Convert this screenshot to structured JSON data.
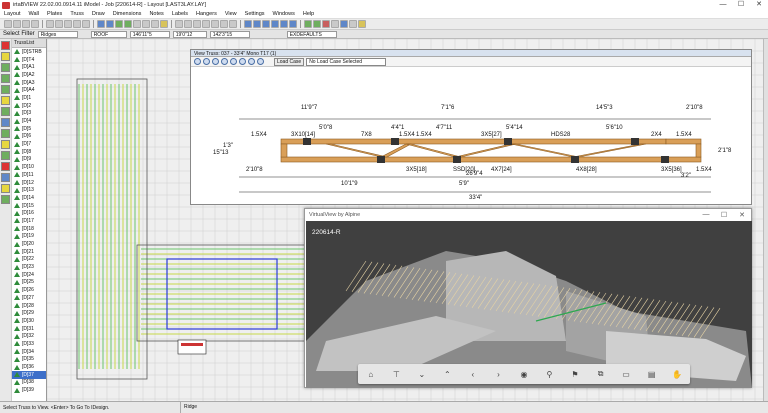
{
  "window": {
    "title": "irtaBVIEW 22.02.00.0914.11 iModel - Job [220614-R] - Layout [LAST3LAY.LAY]",
    "minimize": "—",
    "maximize": "☐",
    "close": "✕"
  },
  "menu": [
    "Layout",
    "Wall",
    "Plates",
    "Truss",
    "Draw",
    "Dimensions",
    "Notes",
    "Labels",
    "Hangers",
    "View",
    "Settings",
    "Windows",
    "Help"
  ],
  "filters": {
    "label": "Select Filter",
    "ridge": "Ridges",
    "level": "ROOF",
    "coord1": "146'11\"5",
    "coord2": "19'0\"12",
    "coord3": "142'3\"15",
    "layer": "EXDEFAULTS"
  },
  "truss_list": {
    "header": "TrussList",
    "items": [
      "[D]STRB",
      "[D]T4",
      "[D]A1",
      "[D]A2",
      "[D]A3",
      "[D]A4",
      "[D]1",
      "[D]2",
      "[D]3",
      "[D]4",
      "[D]5",
      "[D]6",
      "[D]7",
      "[D]8",
      "[D]9",
      "[D]10",
      "[D]11",
      "[D]12",
      "[D]13",
      "[D]14",
      "[D]15",
      "[D]16",
      "[D]17",
      "[D]18",
      "[D]19",
      "[D]20",
      "[D]21",
      "[D]22",
      "[D]23",
      "[D]24",
      "[D]25",
      "[D]26",
      "[D]27",
      "[D]28",
      "[D]29",
      "[D]30",
      "[D]31",
      "[D]32",
      "[D]33",
      "[D]34",
      "[D]35",
      "[D]36",
      "[D]37",
      "[D]38",
      "[D]39"
    ],
    "selected": "[D]37"
  },
  "truss_view": {
    "title": "View Truss: 037 - 33'4\" Mono T17 (1)",
    "load_case_label": "Load Case",
    "load_case_value": "No Load Case Selected",
    "top_dims": [
      "11'9\"7",
      "7'1\"6",
      "14'5\"3",
      "2'10\"8"
    ],
    "top_dims2": [
      "5'0\"8",
      "4'4\"1",
      "4'7\"11",
      "5'4\"14",
      "5'6\"10"
    ],
    "plates_top": [
      "1.5X4",
      "3X10[14]",
      "7X8",
      "1.5X4",
      "1.5X4",
      "3X5[27]",
      "HDS28",
      "2X4",
      "1.5X4"
    ],
    "plates_bot": [
      "3X5[18]",
      "SSD[20]",
      "4X7[24]",
      "4X8[28]",
      "3X5[36]",
      "1.5X4"
    ],
    "bottom_dims": [
      "10'1\"9",
      "5'9\"",
      "26'9\"4",
      "33'4\"",
      "2'10\"8",
      "3'2\""
    ],
    "heights": [
      "1'3\"",
      "15\"13",
      "2'1\"8"
    ]
  },
  "virtual_view": {
    "title": "VirtualView by Alpine",
    "job": "220614-R",
    "tools": [
      "⌂",
      "⊤",
      "⌄",
      "⌃",
      "‹",
      "›",
      "◉",
      "⚲",
      "⚑",
      "⧉",
      "▭",
      "▤",
      "✋"
    ]
  },
  "status": {
    "message": "Select Truss to View. <Enter> To Go To IDesign.",
    "mode": "Ridge"
  }
}
